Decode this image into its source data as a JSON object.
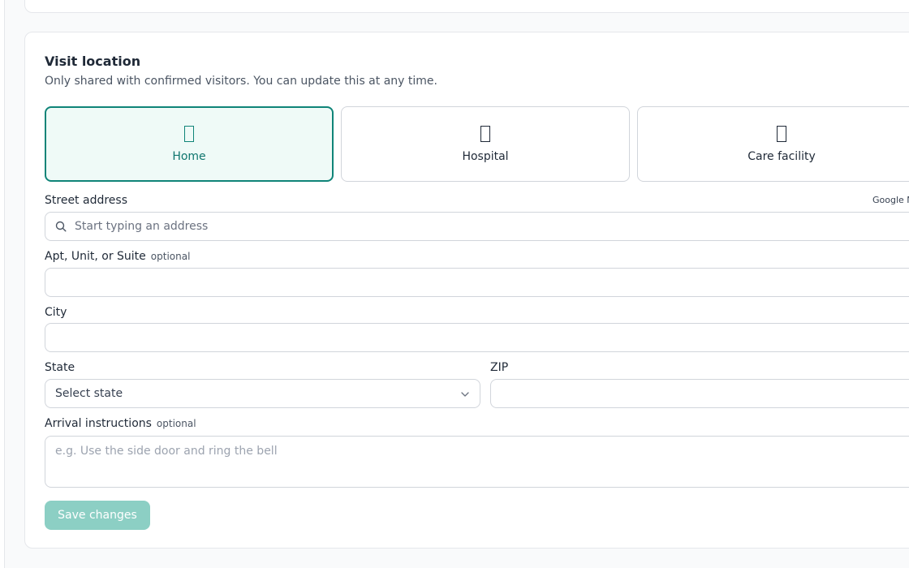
{
  "visit_location": {
    "title": "Visit location",
    "subtitle": "Only shared with confirmed visitors. You can update this at any time.",
    "options": [
      {
        "label": "Home",
        "icon": "home-icon",
        "selected": true
      },
      {
        "label": "Hospital",
        "icon": "hospital-icon",
        "selected": false
      },
      {
        "label": "Care facility",
        "icon": "care-facility-icon",
        "selected": false
      }
    ],
    "street_address": {
      "label": "Street address",
      "placeholder": "Start typing an address",
      "value": "",
      "credit": "Google M"
    },
    "apt": {
      "label": "Apt, Unit, or Suite",
      "optional": "optional",
      "value": ""
    },
    "city": {
      "label": "City",
      "value": ""
    },
    "state": {
      "label": "State",
      "selected": "Select state"
    },
    "zip": {
      "label": "ZIP",
      "value": ""
    },
    "arrival_instructions": {
      "label": "Arrival instructions",
      "optional": "optional",
      "placeholder": "e.g. Use the side door and ring the bell",
      "value": ""
    },
    "save_label": "Save changes"
  },
  "colors": {
    "accent": "#0f8478",
    "selected_bg": "#effaf7",
    "button_disabled": "#8ccfc4",
    "border": "#d1d5db"
  }
}
